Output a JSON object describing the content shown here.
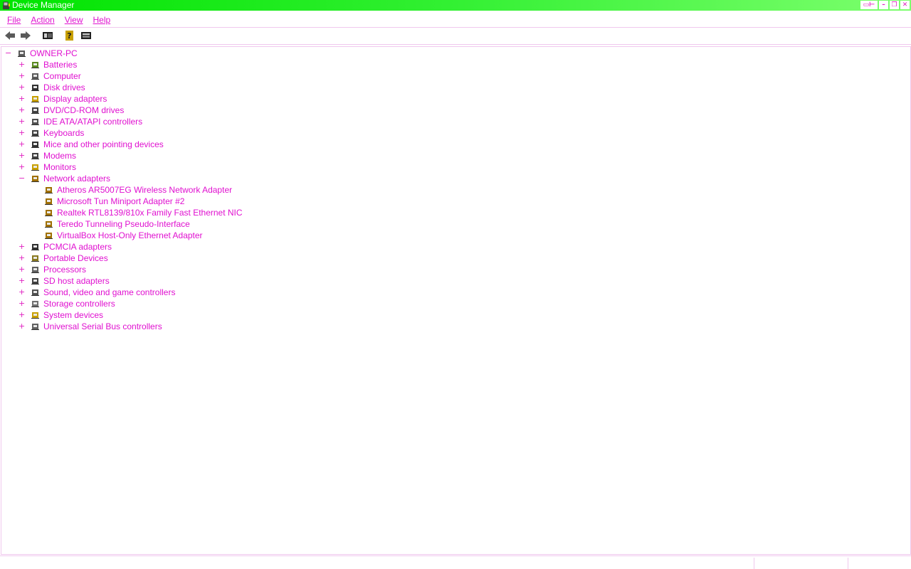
{
  "window": {
    "title": "Device Manager",
    "accent_color": "#00e400",
    "text_color": "#e010d0"
  },
  "menu": {
    "items": [
      {
        "label": "File"
      },
      {
        "label": "Action"
      },
      {
        "label": "View"
      },
      {
        "label": "Help"
      }
    ]
  },
  "toolbar": {
    "icons": [
      "back-arrow-icon",
      "forward-arrow-icon",
      "show-hide-console-tree-icon",
      "help-icon",
      "properties-icon"
    ]
  },
  "tree": {
    "root": {
      "label": "OWNER-PC",
      "expander": "−",
      "icon": "computer-icon"
    },
    "categories": [
      {
        "label": "Batteries",
        "expander": "+",
        "icon": "battery-icon"
      },
      {
        "label": "Computer",
        "expander": "+",
        "icon": "computer-icon"
      },
      {
        "label": "Disk drives",
        "expander": "+",
        "icon": "disk-drive-icon"
      },
      {
        "label": "Display adapters",
        "expander": "+",
        "icon": "display-adapter-icon"
      },
      {
        "label": "DVD/CD-ROM drives",
        "expander": "+",
        "icon": "dvd-drive-icon"
      },
      {
        "label": "IDE ATA/ATAPI controllers",
        "expander": "+",
        "icon": "ide-controller-icon"
      },
      {
        "label": "Keyboards",
        "expander": "+",
        "icon": "keyboard-icon"
      },
      {
        "label": "Mice and other pointing devices",
        "expander": "+",
        "icon": "mouse-icon"
      },
      {
        "label": "Modems",
        "expander": "+",
        "icon": "modem-icon"
      },
      {
        "label": "Monitors",
        "expander": "+",
        "icon": "monitor-icon"
      },
      {
        "label": "Network adapters",
        "expander": "−",
        "icon": "network-adapter-icon",
        "children": [
          {
            "label": "Atheros AR5007EG Wireless Network Adapter",
            "icon": "network-card-icon"
          },
          {
            "label": "Microsoft Tun Miniport Adapter #2",
            "icon": "network-card-icon"
          },
          {
            "label": "Realtek RTL8139/810x Family Fast Ethernet NIC",
            "icon": "network-card-icon"
          },
          {
            "label": "Teredo Tunneling Pseudo-Interface",
            "icon": "network-card-icon"
          },
          {
            "label": "VirtualBox Host-Only Ethernet Adapter",
            "icon": "network-card-icon"
          }
        ]
      },
      {
        "label": "PCMCIA adapters",
        "expander": "+",
        "icon": "pcmcia-icon"
      },
      {
        "label": "Portable Devices",
        "expander": "+",
        "icon": "portable-device-icon"
      },
      {
        "label": "Processors",
        "expander": "+",
        "icon": "processor-icon"
      },
      {
        "label": "SD host adapters",
        "expander": "+",
        "icon": "sd-host-icon"
      },
      {
        "label": "Sound, video and game controllers",
        "expander": "+",
        "icon": "sound-icon"
      },
      {
        "label": "Storage controllers",
        "expander": "+",
        "icon": "storage-controller-icon"
      },
      {
        "label": "System devices",
        "expander": "+",
        "icon": "system-device-icon"
      },
      {
        "label": "Universal Serial Bus controllers",
        "expander": "+",
        "icon": "usb-icon"
      }
    ]
  },
  "statusbar": {
    "panes": [
      "",
      "",
      ""
    ]
  }
}
